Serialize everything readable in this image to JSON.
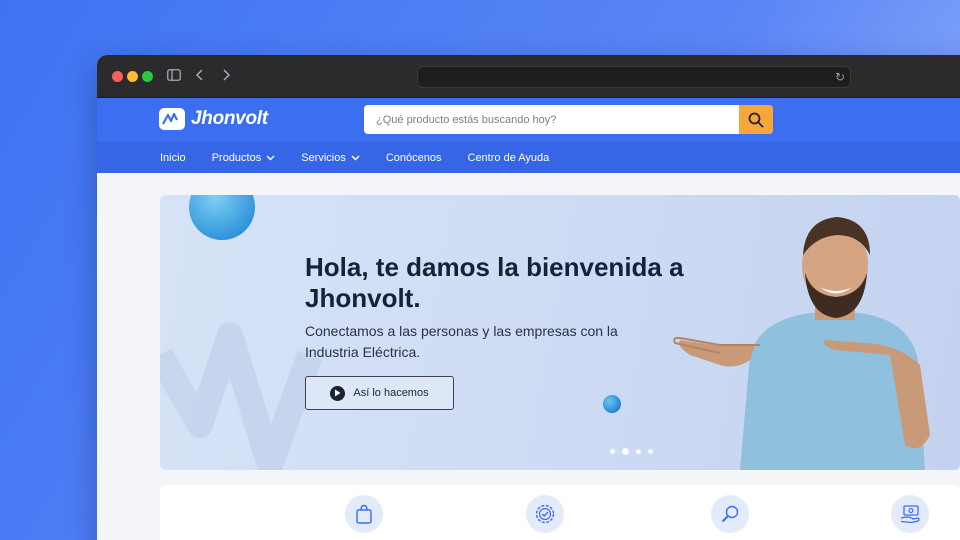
{
  "brand": {
    "name": "Jhonvolt",
    "accent": "#3b6ef1",
    "nav_color": "#3666e6",
    "search_button_color": "#f6a73b"
  },
  "search": {
    "placeholder": "¿Qué producto estás buscando hoy?",
    "value": ""
  },
  "nav": {
    "items": [
      {
        "label": "Inicio"
      },
      {
        "label": "Productos"
      },
      {
        "label": "Servicios"
      },
      {
        "label": "Conócenos"
      },
      {
        "label": "Centro de Ayuda"
      }
    ]
  },
  "hero": {
    "title": "Hola, te damos la bienvenida a Jhonvolt.",
    "subtitle": "Conectamos a las personas y las empresas con la Industria Eléctrica.",
    "button_label": "Así lo hacemos",
    "slides": 4,
    "active_slide": 2
  },
  "features": {
    "icons": [
      "shopping-bag-icon",
      "verified-badge-icon",
      "search-tool-icon",
      "payment-hand-icon"
    ]
  }
}
